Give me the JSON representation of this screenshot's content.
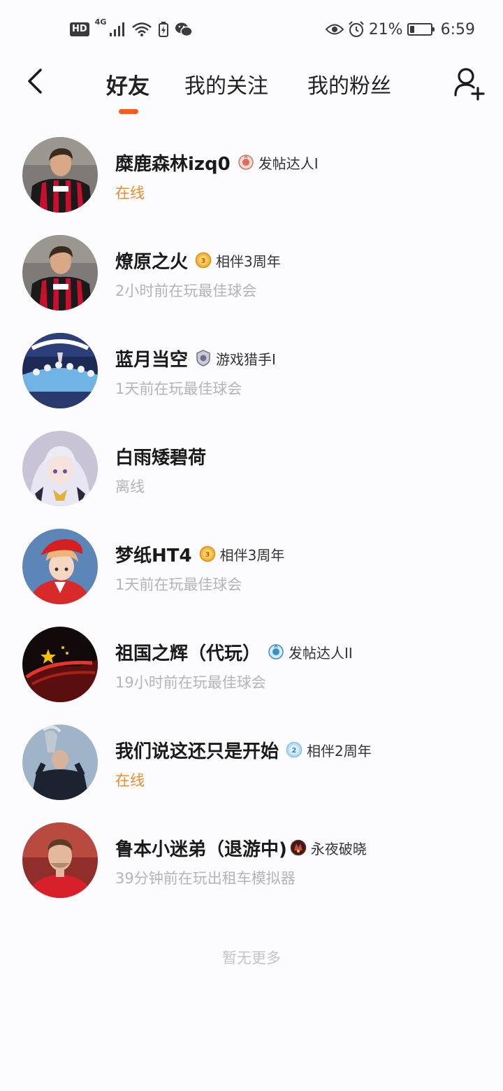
{
  "status_bar": {
    "hd": "HD",
    "network": "4G",
    "battery": "21%",
    "battery_level": 0.21,
    "time": "6:59"
  },
  "header": {
    "tabs": [
      {
        "label": "好友",
        "active": true
      },
      {
        "label": "我的关注",
        "active": false
      },
      {
        "label": "我的粉丝",
        "active": false
      }
    ],
    "accent_color": "#ff5a1a",
    "back_icon": "back-arrow-icon",
    "add_icon": "add-user-icon"
  },
  "friends": [
    {
      "name": "糜鹿森林izq0",
      "badge": "发帖达人I",
      "status": "在线",
      "online": true
    },
    {
      "name": "燎原之火",
      "badge": "相伴3周年",
      "status": "2小时前在玩最佳球会",
      "online": false
    },
    {
      "name": "蓝月当空",
      "badge": "游戏猎手I",
      "status": "1天前在玩最佳球会",
      "online": false
    },
    {
      "name": "白雨矮碧荷",
      "badge": "",
      "status": "离线",
      "online": false
    },
    {
      "name": "梦纸HT4",
      "badge": "相伴3周年",
      "status": "1天前在玩最佳球会",
      "online": false
    },
    {
      "name": "祖国之辉（代玩）",
      "badge": "发帖达人II",
      "status": "19小时前在玩最佳球会",
      "online": false
    },
    {
      "name": "我们说这还只是开始",
      "badge": "相伴2周年",
      "status": "在线",
      "online": true
    },
    {
      "name": "鲁本小迷弟（退游中)",
      "badge": "永夜破晓",
      "status": "39分钟前在玩出租车模拟器",
      "online": false
    }
  ],
  "list_end": "暂无更多",
  "colors": {
    "online": "#f08a2c",
    "offline": "#b3b3b8",
    "background": "#fcfcfe"
  }
}
